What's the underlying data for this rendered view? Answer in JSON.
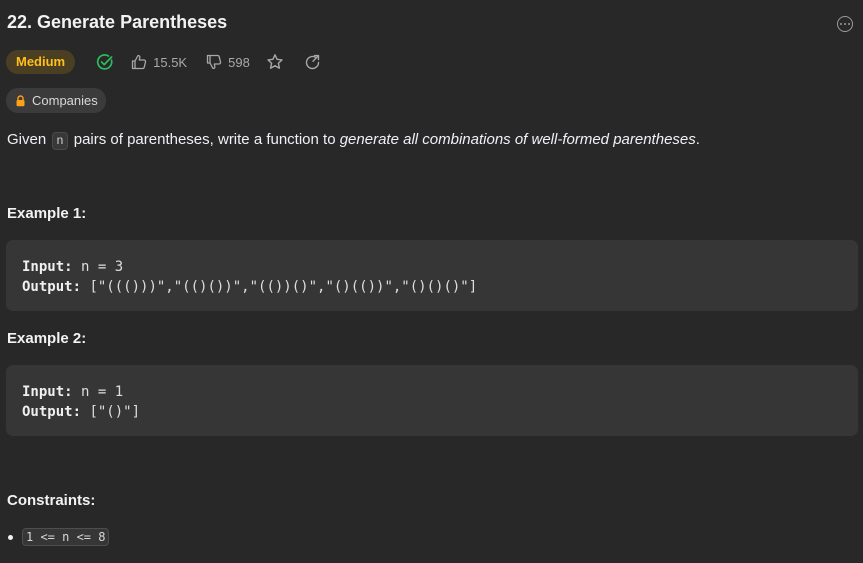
{
  "problem": {
    "title": "22. Generate Parentheses",
    "difficulty": "Medium",
    "likes": "15.5K",
    "dislikes": "598",
    "companies_label": "Companies"
  },
  "description": {
    "part1": "Given ",
    "var": "n",
    "part2": " pairs of parentheses, write a function to ",
    "emphasis": "generate all combinations of well-formed parentheses",
    "part3": "."
  },
  "examples": [
    {
      "heading": "Example 1:",
      "input_label": "Input:",
      "input_value": " n = 3",
      "output_label": "Output:",
      "output_value": " [\"((()))\",\"(()())\",\"(())()\",\"()(())\",\"()()()\"]"
    },
    {
      "heading": "Example 2:",
      "input_label": "Input:",
      "input_value": " n = 1",
      "output_label": "Output:",
      "output_value": " [\"()\"]"
    }
  ],
  "constraints": {
    "heading": "Constraints:",
    "items": [
      "1 <= n <= 8"
    ]
  },
  "colors": {
    "medium": "#ffc01e",
    "solved": "#2cbb5d",
    "background": "#282828"
  },
  "icons": {
    "more": "more-icon",
    "solved": "check-circle-icon",
    "like": "thumbs-up-icon",
    "dislike": "thumbs-down-icon",
    "star": "star-icon",
    "share": "share-icon",
    "lock": "lock-icon"
  }
}
